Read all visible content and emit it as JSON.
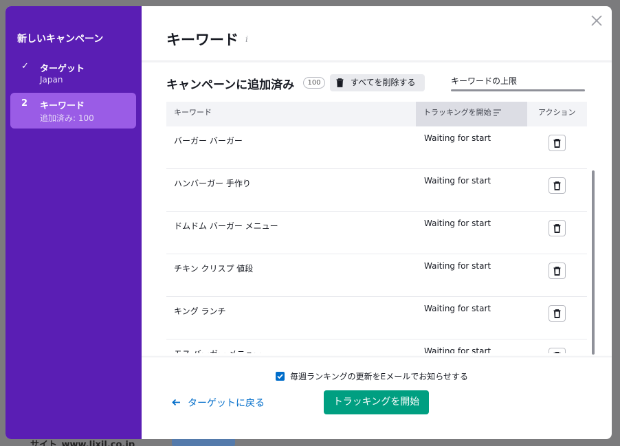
{
  "background": {
    "site_text": "サイト_www.lixil.co.jp"
  },
  "sidebar": {
    "title": "新しいキャンペーン",
    "steps": [
      {
        "mark": "✓",
        "name": "ターゲット",
        "sub": "Japan"
      },
      {
        "mark": "2",
        "name": "キーワード",
        "sub": "追加済み: 100"
      }
    ]
  },
  "main": {
    "title": "キーワード",
    "info": "i",
    "section_title": "キャンペーンに追加済み",
    "count": "100",
    "delete_all_label": "すべてを削除する",
    "limit_label": "キーワードの上限"
  },
  "table": {
    "headers": [
      "キーワード",
      "トラッキングを開始",
      "アクション"
    ],
    "rows": [
      {
        "keyword": "バーガー バーガー",
        "status": "Waiting for start"
      },
      {
        "keyword": "ハンバーガー 手作り",
        "status": "Waiting for start"
      },
      {
        "keyword": "ドムドム バーガー メニュー",
        "status": "Waiting for start"
      },
      {
        "keyword": "チキン クリスプ 値段",
        "status": "Waiting for start"
      },
      {
        "keyword": "キング ランチ",
        "status": "Waiting for start"
      },
      {
        "keyword": "モス バーガー メニュー",
        "status": "Waiting for start"
      }
    ]
  },
  "footer": {
    "email_checkbox_label": "毎週ランキングの更新をEメールでお知らせする",
    "email_checked": true,
    "back_label": "ターゲットに戻る",
    "start_label": "トラッキングを開始"
  },
  "colors": {
    "sidebar": "#5a1eb4",
    "active_step": "#9a5ce6",
    "primary": "#009f81",
    "link": "#006dca"
  }
}
